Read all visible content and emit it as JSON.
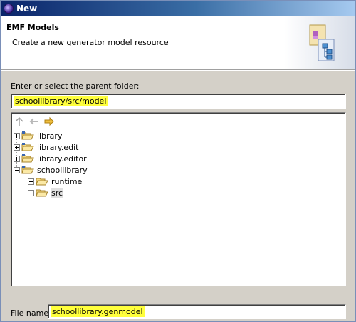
{
  "window": {
    "title": "New"
  },
  "header": {
    "title": "EMF Models",
    "description": "Create a new generator model resource"
  },
  "parent_folder": {
    "label": "Enter or select the parent folder:",
    "value": "schoollibrary/src/model"
  },
  "tree": {
    "toolbar": {
      "up_icon": "up-folder-icon",
      "back_icon": "back-arrow-icon",
      "forward_icon": "forward-arrow-icon"
    },
    "items": [
      {
        "label": "library",
        "expanded": false
      },
      {
        "label": "library.edit",
        "expanded": false
      },
      {
        "label": "library.editor",
        "expanded": false
      },
      {
        "label": "schoollibrary",
        "expanded": true
      },
      {
        "label": "runtime",
        "expanded": false
      },
      {
        "label": "src",
        "expanded": false,
        "selected": true
      }
    ]
  },
  "file_name": {
    "label": "File name:",
    "value": "schoollibrary.genmodel"
  },
  "colors": {
    "highlight": "#ffff3c",
    "titlebar_start": "#0a246a",
    "titlebar_end": "#a6caf0"
  }
}
